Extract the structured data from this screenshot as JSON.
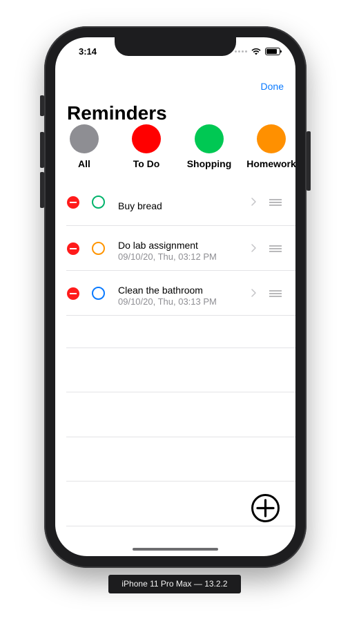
{
  "status_bar": {
    "time": "3:14"
  },
  "header": {
    "done_label": "Done",
    "title": "Reminders"
  },
  "lists": [
    {
      "label": "All",
      "color": "#8e8e93"
    },
    {
      "label": "To Do",
      "color": "#ff0000"
    },
    {
      "label": "Shopping",
      "color": "#00c853"
    },
    {
      "label": "Homework",
      "color": "#ff9000"
    }
  ],
  "reminders": [
    {
      "title": "Buy bread",
      "date": "",
      "circle_color": "#00b36b"
    },
    {
      "title": "Do lab assignment",
      "date": "09/10/20, Thu, 03:12 PM",
      "circle_color": "#ff9500"
    },
    {
      "title": "Clean the bathroom",
      "date": "09/10/20, Thu, 03:13 PM",
      "circle_color": "#0a7aff"
    }
  ],
  "simulator": {
    "device_label": "iPhone 11 Pro Max — 13.2.2"
  }
}
